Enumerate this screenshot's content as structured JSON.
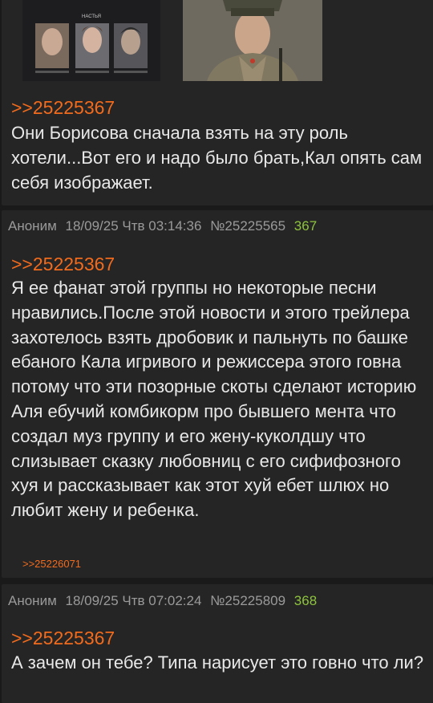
{
  "post1": {
    "reply_to": ">>25225367",
    "text": "Они Борисова сначала взять на эту роль хотели...Вот его и надо было брать,Кал опять сам себя изображает.",
    "images": [
      {
        "icon": "image-thumbnail-icon",
        "caption": "НАСТЬЯ"
      },
      {
        "icon": "image-thumbnail-icon"
      }
    ]
  },
  "post2": {
    "author": "Аноним",
    "datetime": "18/09/25 Чтв 03:14:36",
    "post_id": "№25225565",
    "number": "367",
    "reply_to": ">>25225367",
    "text": "Я ее фанат этой группы но некоторые песни нравились.После этой новости и этого трейлера захотелось взять дробовик и пальнуть по башке ебаного Кала игривого и режиссера этого говна потому что эти позорные скоты сделают историю Аля ебучий комбикорм про бывшего мента что создал муз группу и его жену-куколдшу что слизывает сказку любовниц с его сифифозного хуя и рассказывает как этот хуй ебет шлюх но любит жену и ребенка.",
    "backlink": ">>25226071"
  },
  "post3": {
    "author": "Аноним",
    "datetime": "18/09/25 Чтв 07:02:24",
    "post_id": "№25225809",
    "number": "368",
    "reply_to": ">>25225367",
    "text": "А зачем он тебе? Типа нарисует это говно что ли?"
  },
  "colors": {
    "background": "#1a1a1a",
    "post_background": "#252525",
    "reply_link": "#f26b1d",
    "post_number": "#8ec43d",
    "text": "#e8e8e8",
    "meta": "#9a9a9a"
  }
}
